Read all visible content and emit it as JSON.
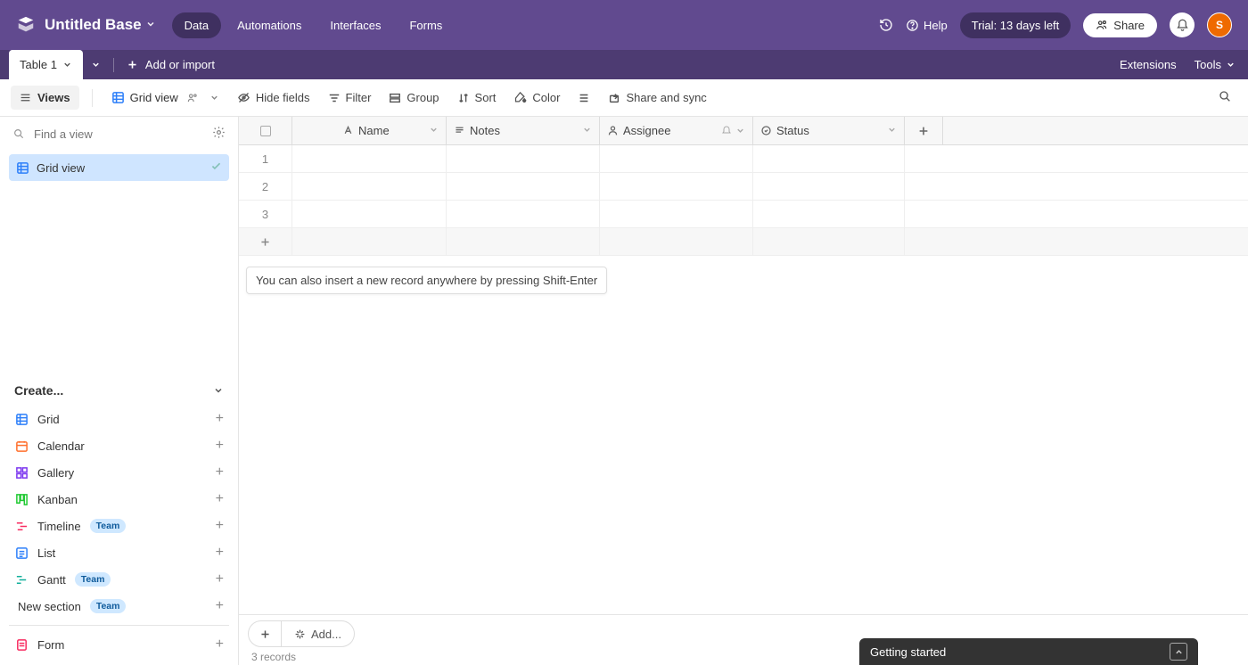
{
  "header": {
    "base_title": "Untitled Base",
    "nav": {
      "data": "Data",
      "automations": "Automations",
      "interfaces": "Interfaces",
      "forms": "Forms"
    },
    "help": "Help",
    "trial": "Trial: 13 days left",
    "share": "Share",
    "avatar_initial": "S"
  },
  "tabs": {
    "table1": "Table 1",
    "add_import": "Add or import",
    "extensions": "Extensions",
    "tools": "Tools"
  },
  "toolbar": {
    "views": "Views",
    "grid_view": "Grid view",
    "hide_fields": "Hide fields",
    "filter": "Filter",
    "group": "Group",
    "sort": "Sort",
    "color": "Color",
    "share_sync": "Share and sync"
  },
  "sidebar": {
    "find_placeholder": "Find a view",
    "view_item": "Grid view",
    "create_header": "Create...",
    "items": [
      {
        "label": "Grid",
        "color": "c-blue",
        "icon": "grid"
      },
      {
        "label": "Calendar",
        "color": "c-orange",
        "icon": "calendar"
      },
      {
        "label": "Gallery",
        "color": "c-purple",
        "icon": "gallery"
      },
      {
        "label": "Kanban",
        "color": "c-green",
        "icon": "kanban"
      },
      {
        "label": "Timeline",
        "color": "c-red",
        "icon": "timeline",
        "team": true
      },
      {
        "label": "List",
        "color": "c-blue",
        "icon": "list"
      },
      {
        "label": "Gantt",
        "color": "c-teal",
        "icon": "gantt",
        "team": true
      }
    ],
    "new_section": "New section",
    "team_badge": "Team",
    "form": "Form"
  },
  "grid": {
    "columns": {
      "name": "Name",
      "notes": "Notes",
      "assignee": "Assignee",
      "status": "Status"
    },
    "rows": [
      "1",
      "2",
      "3"
    ],
    "tip": "You can also insert a new record anywhere by pressing Shift-Enter",
    "add_label": "Add...",
    "records_count": "3 records"
  },
  "getting_started": "Getting started"
}
